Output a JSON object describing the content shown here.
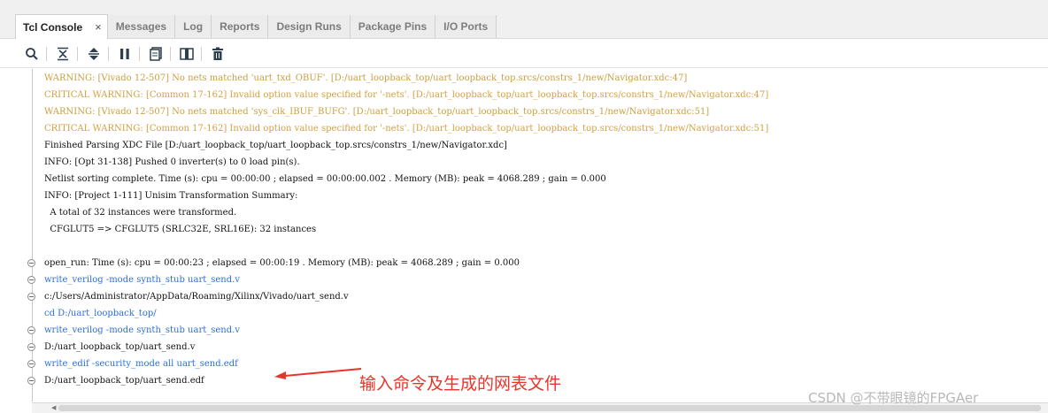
{
  "tabs": [
    {
      "label": "Tcl Console",
      "active": true,
      "close": "×"
    },
    {
      "label": "Messages"
    },
    {
      "label": "Log"
    },
    {
      "label": "Reports"
    },
    {
      "label": "Design Runs"
    },
    {
      "label": "Package Pins"
    },
    {
      "label": "I/O Ports"
    }
  ],
  "toolbar": {
    "icons": [
      "search-icon",
      "collapse-all-icon",
      "expand-all-icon",
      "pause-icon",
      "copy-icon",
      "columns-icon",
      "delete-icon"
    ]
  },
  "console": {
    "lines": [
      {
        "text": "WARNING: [Vivado 12-507] No nets matched 'uart_txd_OBUF'. [D:/uart_loopback_top/uart_loopback_top.srcs/constrs_1/new/Navigator.xdc:47]",
        "kind": "warning"
      },
      {
        "text": "CRITICAL WARNING: [Common 17-162] Invalid option value specified for '-nets'. [D:/uart_loopback_top/uart_loopback_top.srcs/constrs_1/new/Navigator.xdc:47]",
        "kind": "critical"
      },
      {
        "text": "WARNING: [Vivado 12-507] No nets matched 'sys_clk_IBUF_BUFG'. [D:/uart_loopback_top/uart_loopback_top.srcs/constrs_1/new/Navigator.xdc:51]",
        "kind": "warning"
      },
      {
        "text": "CRITICAL WARNING: [Common 17-162] Invalid option value specified for '-nets'. [D:/uart_loopback_top/uart_loopback_top.srcs/constrs_1/new/Navigator.xdc:51]",
        "kind": "critical"
      },
      {
        "text": "Finished Parsing XDC File [D:/uart_loopback_top/uart_loopback_top.srcs/constrs_1/new/Navigator.xdc]",
        "kind": "normal"
      },
      {
        "text": "INFO: [Opt 31-138] Pushed 0 inverter(s) to 0 load pin(s).",
        "kind": "normal"
      },
      {
        "text": "Netlist sorting complete. Time (s): cpu = 00:00:00 ; elapsed = 00:00:00.002 . Memory (MB): peak = 4068.289 ; gain = 0.000",
        "kind": "normal"
      },
      {
        "text": "INFO: [Project 1-111] Unisim Transformation Summary:",
        "kind": "normal"
      },
      {
        "text": "  A total of 32 instances were transformed.",
        "kind": "normal"
      },
      {
        "text": "  CFGLUT5 => CFGLUT5 (SRLC32E, SRL16E): 32 instances",
        "kind": "normal"
      },
      {
        "text": "",
        "kind": "normal"
      },
      {
        "text": "open_run: Time (s): cpu = 00:00:23 ; elapsed = 00:00:19 . Memory (MB): peak = 4068.289 ; gain = 0.000",
        "kind": "normal",
        "marker": true
      },
      {
        "text": "write_verilog -mode synth_stub uart_send.v",
        "kind": "command",
        "marker": true
      },
      {
        "text": "c:/Users/Administrator/AppData/Roaming/Xilinx/Vivado/uart_send.v",
        "kind": "normal",
        "marker": true
      },
      {
        "text": "cd D:/uart_loopback_top/",
        "kind": "command"
      },
      {
        "text": "write_verilog -mode synth_stub uart_send.v",
        "kind": "command",
        "marker": true
      },
      {
        "text": "D:/uart_loopback_top/uart_send.v",
        "kind": "normal",
        "marker": true
      },
      {
        "text": "write_edif -security_mode all uart_send.edf",
        "kind": "command",
        "marker": true
      },
      {
        "text": "D:/uart_loopback_top/uart_send.edf",
        "kind": "normal",
        "marker": true
      }
    ]
  },
  "annotation": {
    "text": "输入命令及生成的网表文件",
    "color": "#e8352a"
  },
  "watermark": "CSDN @不带眼镜的FPGAer"
}
